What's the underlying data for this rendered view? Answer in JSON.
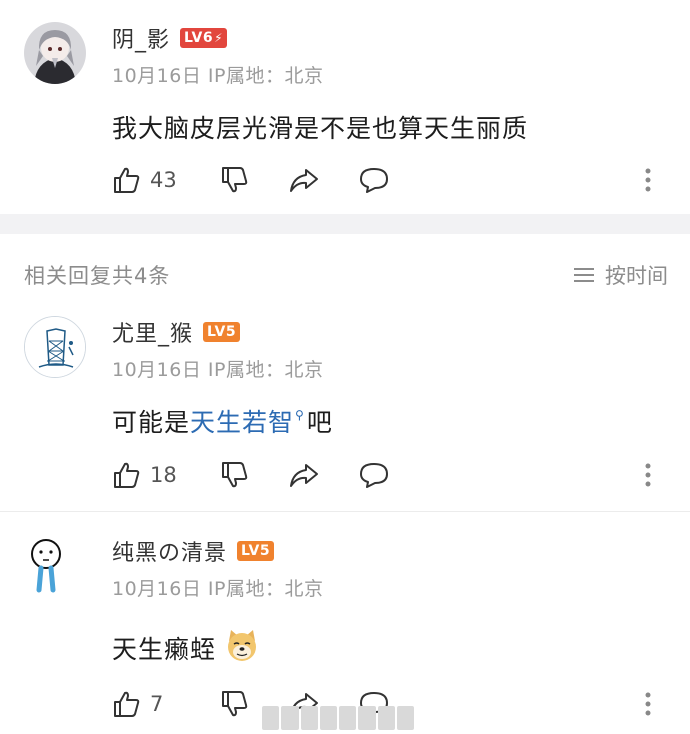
{
  "main_comment": {
    "username": "阴_影",
    "level": "LV6",
    "date": "10月16日",
    "ip": "IP属地：北京",
    "text": "我大脑皮层光滑是不是也算天生丽质",
    "likes": "43"
  },
  "replies_header": {
    "title": "相关回复共4条",
    "sort_label": "按时间"
  },
  "replies": [
    {
      "username": "尤里_猴",
      "level": "LV5",
      "date": "10月16日",
      "ip": "IP属地：北京",
      "text_before": "可能是",
      "text_link": "天生若智",
      "text_after": "吧",
      "likes": "18"
    },
    {
      "username": "纯黑の清景",
      "level": "LV5",
      "date": "10月16日",
      "ip": "IP属地：北京",
      "text": "天生癞蛭",
      "likes": "7"
    }
  ],
  "colors": {
    "lv6": "#e2463d",
    "lv5": "#f0822e",
    "link": "#2c6bb3"
  }
}
